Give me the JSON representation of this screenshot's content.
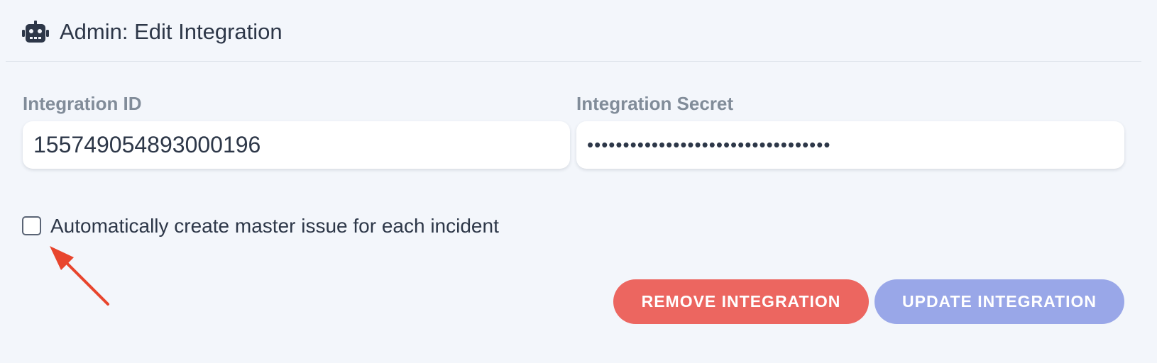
{
  "header": {
    "icon": "robot-icon",
    "title": "Admin: Edit Integration"
  },
  "form": {
    "integration_id": {
      "label": "Integration ID",
      "value": "1557490548930​00196"
    },
    "integration_secret": {
      "label": "Integration Secret",
      "value": "••••••••••••••••••••••••••••••••••"
    },
    "master_issue_checkbox": {
      "label": "Automatically create master issue for each incident",
      "checked": false
    }
  },
  "annotation": {
    "icon": "arrow-icon",
    "color": "#e8452d"
  },
  "actions": {
    "remove_label": "REMOVE INTEGRATION",
    "update_label": "UPDATE INTEGRATION"
  },
  "colors": {
    "background": "#f3f6fb",
    "text": "#2d3748",
    "label": "#818c99",
    "remove_button": "#ec6660",
    "update_button": "#99a7e8"
  }
}
